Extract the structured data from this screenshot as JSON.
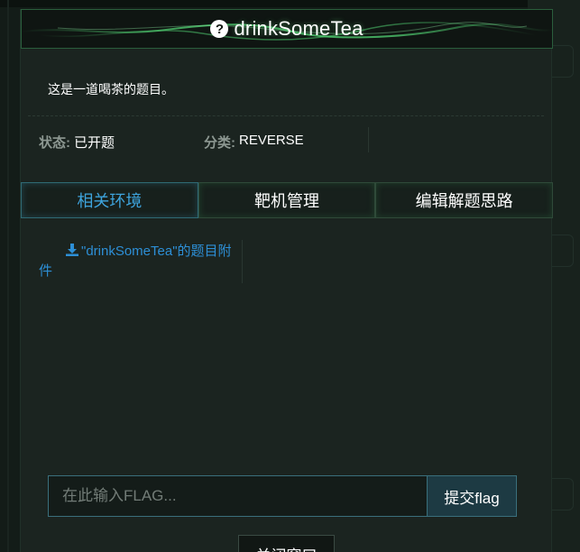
{
  "header": {
    "title": "drinkSomeTea",
    "icon": "question-circle-icon"
  },
  "description": "这是一道喝茶的题目。",
  "meta": {
    "status_label": "状态:",
    "status_value": "已开题",
    "category_label": "分类:",
    "category_value": "REVERSE"
  },
  "tabs": [
    {
      "label": "相关环境",
      "active": true
    },
    {
      "label": "靶机管理",
      "active": false
    },
    {
      "label": "编辑解题思路",
      "active": false
    }
  ],
  "attachment": {
    "label": "\"drinkSomeTea\"的题目附件",
    "icon": "download-icon"
  },
  "flag": {
    "placeholder": "在此输入FLAG...",
    "value": "",
    "submit_label": "提交flag"
  },
  "close_label": "关闭窗口",
  "colors": {
    "accent_blue": "#3ea4dd",
    "link_blue": "#2d8fd6",
    "header_glow": "#56e07a",
    "panel_bg": "#1b2420"
  }
}
